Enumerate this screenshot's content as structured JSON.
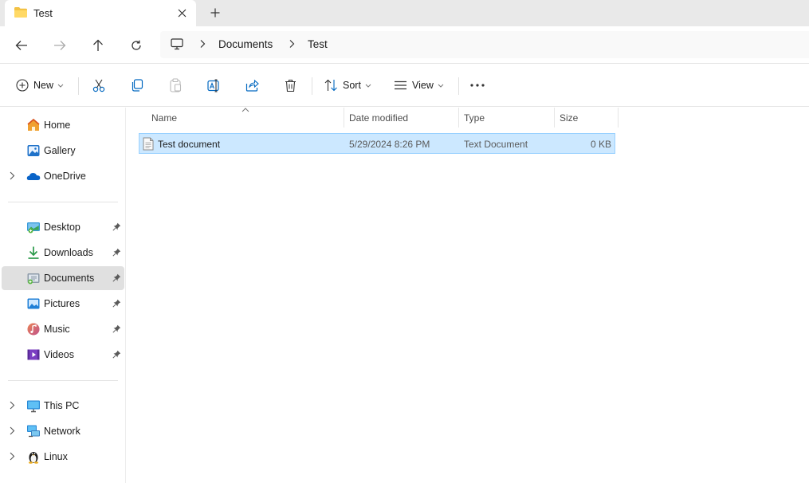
{
  "tab": {
    "title": "Test",
    "close_icon": "close-icon",
    "new_tab_icon": "plus-icon"
  },
  "nav": {
    "back": "back-arrow-icon",
    "forward": "forward-arrow-icon",
    "up": "up-arrow-icon",
    "refresh": "refresh-icon"
  },
  "breadcrumb": {
    "root_icon": "this-pc-icon",
    "items": [
      "Documents",
      "Test"
    ]
  },
  "toolbar": {
    "new_label": "New",
    "sort_label": "Sort",
    "view_label": "View"
  },
  "sidebar": {
    "group1": [
      {
        "label": "Home",
        "icon": "home-icon"
      },
      {
        "label": "Gallery",
        "icon": "gallery-icon"
      },
      {
        "label": "OneDrive",
        "icon": "onedrive-icon"
      }
    ],
    "quick": [
      {
        "label": "Desktop",
        "icon": "desktop-icon"
      },
      {
        "label": "Downloads",
        "icon": "downloads-icon"
      },
      {
        "label": "Documents",
        "icon": "documents-icon"
      },
      {
        "label": "Pictures",
        "icon": "pictures-icon"
      },
      {
        "label": "Music",
        "icon": "music-icon"
      },
      {
        "label": "Videos",
        "icon": "videos-icon"
      }
    ],
    "devices": [
      {
        "label": "This PC",
        "icon": "this-pc-icon"
      },
      {
        "label": "Network",
        "icon": "network-icon"
      },
      {
        "label": "Linux",
        "icon": "linux-icon"
      }
    ]
  },
  "columns": {
    "name": "Name",
    "date": "Date modified",
    "type": "Type",
    "size": "Size"
  },
  "files": [
    {
      "name": "Test document",
      "date": "5/29/2024 8:26 PM",
      "type": "Text Document",
      "size": "0 KB"
    }
  ],
  "colors": {
    "accent": "#0067c0",
    "selection": "#cce8ff",
    "selection_border": "#99d1ff",
    "folder": "#f3c244"
  }
}
